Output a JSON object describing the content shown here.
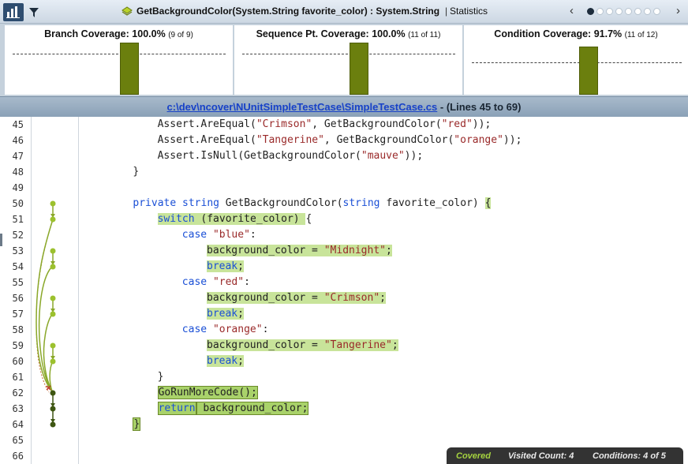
{
  "toolbar": {
    "method_title": "GetBackgroundColor(System.String favorite_color) : System.String",
    "separator": "|",
    "stats_label": "Statistics",
    "prev_arrow": "‹",
    "next_arrow": "›",
    "page_dots": 8,
    "active_dot": 0
  },
  "panels": [
    {
      "label": "Branch Coverage:",
      "percent": "100.0%",
      "count": "(9 of 9)",
      "value": 1.0
    },
    {
      "label": "Sequence Pt. Coverage:",
      "percent": "100.0%",
      "count": "(11 of 11)",
      "value": 1.0
    },
    {
      "label": "Condition Coverage:",
      "percent": "91.7%",
      "count": "(11 of 12)",
      "value": 0.917
    }
  ],
  "file": {
    "path": "c:\\dev\\ncover\\NUnitSimpleTestCase\\SimpleTestCase.cs",
    "range": "- (Lines 45 to 69)"
  },
  "lines": [
    {
      "no": "45",
      "indent": 12,
      "tokens": [
        {
          "t": "Assert.AreEqual("
        },
        {
          "t": "\"Crimson\"",
          "c": "str"
        },
        {
          "t": ", GetBackgroundColor("
        },
        {
          "t": "\"red\"",
          "c": "str"
        },
        {
          "t": "));"
        }
      ]
    },
    {
      "no": "46",
      "indent": 12,
      "tokens": [
        {
          "t": "Assert.AreEqual("
        },
        {
          "t": "\"Tangerine\"",
          "c": "str"
        },
        {
          "t": ", GetBackgroundColor("
        },
        {
          "t": "\"orange\"",
          "c": "str"
        },
        {
          "t": "));"
        }
      ]
    },
    {
      "no": "47",
      "indent": 12,
      "tokens": [
        {
          "t": "Assert.IsNull(GetBackgroundColor("
        },
        {
          "t": "\"mauve\"",
          "c": "str"
        },
        {
          "t": "));"
        }
      ]
    },
    {
      "no": "48",
      "indent": 8,
      "tokens": [
        {
          "t": "}"
        }
      ]
    },
    {
      "no": "49",
      "indent": 0,
      "tokens": []
    },
    {
      "no": "50",
      "indent": 8,
      "tokens": [
        {
          "t": "private",
          "c": "kw"
        },
        {
          "t": " "
        },
        {
          "t": "string",
          "c": "kw"
        },
        {
          "t": " GetBackgroundColor("
        },
        {
          "t": "string",
          "c": "kw"
        },
        {
          "t": " favorite_color) "
        },
        {
          "t": "{",
          "c": "cov"
        }
      ]
    },
    {
      "no": "51",
      "indent": 12,
      "tokens": [
        {
          "t": "switch",
          "c": "kw cov"
        },
        {
          "t": " (favorite_color) ",
          "c": "cov"
        },
        {
          "t": "{"
        }
      ]
    },
    {
      "no": "52",
      "indent": 16,
      "tokens": [
        {
          "t": "case",
          "c": "kw"
        },
        {
          "t": " "
        },
        {
          "t": "\"blue\"",
          "c": "str"
        },
        {
          "t": ":"
        }
      ]
    },
    {
      "no": "53",
      "indent": 20,
      "tokens": [
        {
          "t": "background_color = ",
          "c": "cov"
        },
        {
          "t": "\"Midnight\"",
          "c": "str cov"
        },
        {
          "t": ";",
          "c": "cov"
        }
      ]
    },
    {
      "no": "54",
      "indent": 20,
      "tokens": [
        {
          "t": "break",
          "c": "kw cov"
        },
        {
          "t": ";",
          "c": "cov"
        }
      ]
    },
    {
      "no": "55",
      "indent": 16,
      "tokens": [
        {
          "t": "case",
          "c": "kw"
        },
        {
          "t": " "
        },
        {
          "t": "\"red\"",
          "c": "str"
        },
        {
          "t": ":"
        }
      ]
    },
    {
      "no": "56",
      "indent": 20,
      "tokens": [
        {
          "t": "background_color = ",
          "c": "cov"
        },
        {
          "t": "\"Crimson\"",
          "c": "str cov"
        },
        {
          "t": ";",
          "c": "cov"
        }
      ]
    },
    {
      "no": "57",
      "indent": 20,
      "tokens": [
        {
          "t": "break",
          "c": "kw cov"
        },
        {
          "t": ";",
          "c": "cov"
        }
      ]
    },
    {
      "no": "58",
      "indent": 16,
      "tokens": [
        {
          "t": "case",
          "c": "kw"
        },
        {
          "t": " "
        },
        {
          "t": "\"orange\"",
          "c": "str"
        },
        {
          "t": ":"
        }
      ]
    },
    {
      "no": "59",
      "indent": 20,
      "tokens": [
        {
          "t": "background_color = ",
          "c": "cov"
        },
        {
          "t": "\"Tangerine\"",
          "c": "str cov"
        },
        {
          "t": ";",
          "c": "cov"
        }
      ]
    },
    {
      "no": "60",
      "indent": 20,
      "tokens": [
        {
          "t": "break",
          "c": "kw cov"
        },
        {
          "t": ";",
          "c": "cov"
        }
      ]
    },
    {
      "no": "61",
      "indent": 12,
      "tokens": [
        {
          "t": "}"
        }
      ]
    },
    {
      "no": "62",
      "indent": 12,
      "tokens": [
        {
          "t": "GoRunMoreCode();",
          "c": "cov-strong"
        }
      ]
    },
    {
      "no": "63",
      "indent": 12,
      "tokens": [
        {
          "t": "return",
          "c": "kw cov-strong"
        },
        {
          "t": " background_color;",
          "c": "cov-strong"
        }
      ]
    },
    {
      "no": "64",
      "indent": 8,
      "tokens": [
        {
          "t": "}",
          "c": "cov-strong"
        }
      ]
    },
    {
      "no": "65",
      "indent": 0,
      "tokens": []
    },
    {
      "no": "66",
      "indent": 0,
      "tokens": []
    }
  ],
  "status": {
    "covered": "Covered",
    "visited": "Visited Count: 4",
    "conditions": "Conditions: 4 of 5"
  },
  "colors": {
    "covered_bg": "#c8e49a",
    "covered_strong_bg": "#a9d26a",
    "bar_fill": "#6b7f0e",
    "keyword": "#1a4fd6",
    "string": "#9a2a2a",
    "status_covered": "#a5d23f"
  },
  "icons": {
    "toolbar_chart": "bar-chart-icon",
    "toolbar_filter": "filter-icon",
    "method": "method-icon"
  }
}
